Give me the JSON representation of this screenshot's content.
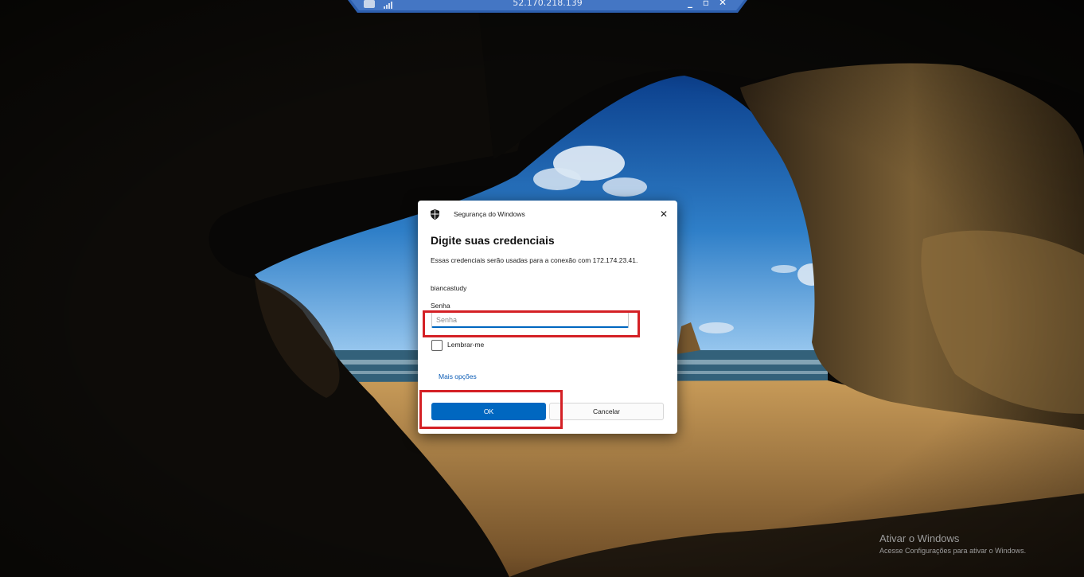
{
  "remote_bar": {
    "host_ip": "52.170.218.139",
    "pin_icon": "pin-icon",
    "signal_icon": "signal-icon",
    "minimize_icon": "minimize-icon",
    "restore_icon": "restore-icon",
    "close_icon": "close-icon"
  },
  "dialog": {
    "title": "Segurança do Windows",
    "title_icon": "shield-icon",
    "close_label": "✕",
    "heading": "Digite suas credenciais",
    "description": "Essas credenciais serão usadas para a conexão com 172.174.23.41.",
    "username": "biancastudy",
    "password_label": "Senha",
    "password_placeholder": "Senha",
    "password_value": "",
    "remember_label": "Lembrar-me",
    "remember_checked": false,
    "more_options": "Mais opções",
    "ok_label": "OK",
    "cancel_label": "Cancelar"
  },
  "activation": {
    "title": "Ativar o Windows",
    "subtitle": "Acesse Configurações para ativar o Windows."
  },
  "colors": {
    "accent": "#0067c0",
    "highlight": "#d42025",
    "link": "#0a5bb5"
  }
}
